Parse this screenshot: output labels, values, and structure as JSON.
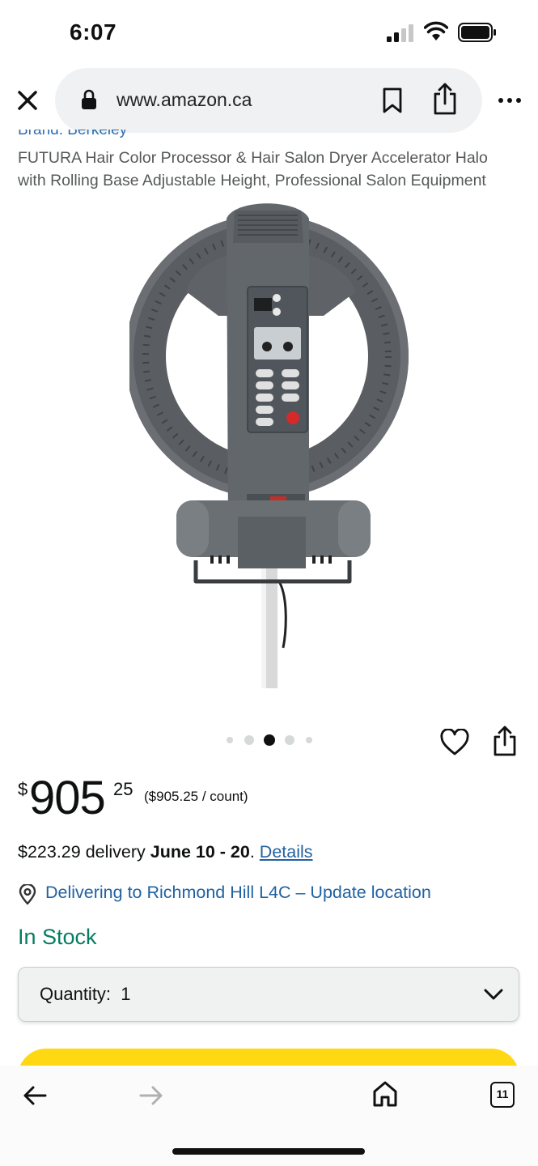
{
  "status_bar": {
    "time": "6:07"
  },
  "browser": {
    "url": "www.amazon.ca",
    "tab_count": "11"
  },
  "product": {
    "brand_fragment": "Brand: Berkeley",
    "title": "FUTURA Hair Color Processor & Hair Salon Dryer Accelerator Halo with Rolling Base Adjustable Height, Professional Salon Equipment",
    "image_alt": "Hair color processor halo dryer on rolling stand",
    "image_count": 5,
    "active_image_index": 2
  },
  "price": {
    "symbol": "$",
    "whole": "905",
    "fraction": "25",
    "unit_price": "($905.25 / count)"
  },
  "delivery": {
    "prefix": "$223.29 delivery ",
    "dates": "June 10 - 20",
    "suffix": ". ",
    "details_link": "Details"
  },
  "location": {
    "text": "Delivering to Richmond Hill L4C – Update location"
  },
  "stock": {
    "status": "In Stock"
  },
  "quantity": {
    "label": "Quantity:",
    "value": "1"
  },
  "colors": {
    "link": "#2162a1",
    "in_stock": "#067d62",
    "buy_button": "#ffd814",
    "price_text": "#0f1111"
  }
}
